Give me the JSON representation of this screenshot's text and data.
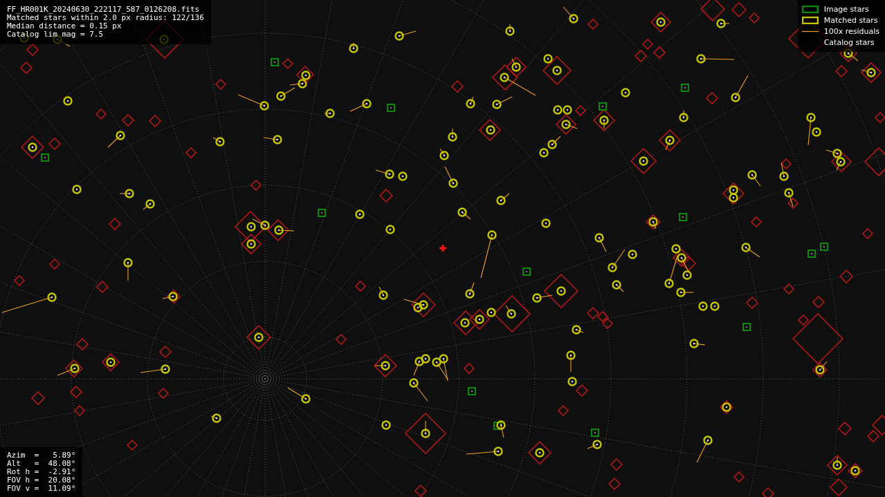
{
  "header": {
    "lines": [
      "FF_HR001K_20240630_222117_587_0126208.fits",
      "Matched stars within 2.0 px radius: 122/136",
      "Median distance = 0.15 px",
      "Catalog lim mag = 7.5"
    ]
  },
  "legend": [
    {
      "kind": "image",
      "label": "Image stars"
    },
    {
      "kind": "matched",
      "label": "Matched stars"
    },
    {
      "kind": "residual",
      "label": "100x residuals"
    },
    {
      "kind": "catalog",
      "label": "Catalog stars"
    }
  ],
  "pointing": [
    "Azim  =   5.89°",
    "Alt   =  48.08°",
    "Rot h =  -2.91°",
    "FOV h =  20.08°",
    "FOV v =  11.09°"
  ]
}
